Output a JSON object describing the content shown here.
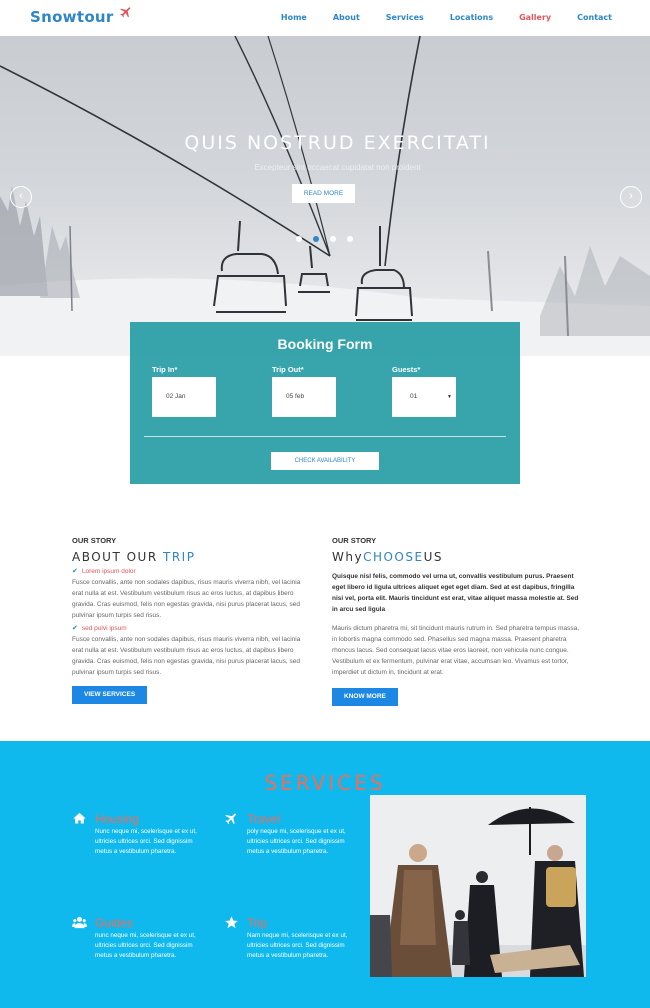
{
  "brand": {
    "name": "Snowtour"
  },
  "nav": {
    "items": [
      {
        "label": "Home",
        "active": false
      },
      {
        "label": "About",
        "active": false
      },
      {
        "label": "Services",
        "active": false
      },
      {
        "label": "Locations",
        "active": false
      },
      {
        "label": "Gallery",
        "active": true
      },
      {
        "label": "Contact",
        "active": false
      }
    ]
  },
  "hero": {
    "title": "QUIS NOSTRUD EXERCITATI",
    "subtitle": "Excepteur sint occaecat cupidatat non proident",
    "button": "READ MORE",
    "prev_icon": "chevron-left-icon",
    "next_icon": "chevron-right-icon",
    "slide_count": 4,
    "active_slide": 2
  },
  "booking": {
    "title": "Booking Form",
    "trip_in": {
      "label": "Trip In*",
      "value": "02 Jan"
    },
    "trip_out": {
      "label": "Trip Out*",
      "value": "05 feb"
    },
    "guests": {
      "label": "Guests*",
      "value": "01"
    },
    "button": "CHECK AVAILABILITY"
  },
  "about": {
    "eyebrow": "OUR STORY",
    "title_plain": "ABOUT OUR ",
    "title_highlight": "TRIP",
    "item1": {
      "heading": "Lorem ipsum dolor",
      "text": "Fusce convallis, ante non sodales dapibus, risus mauris viverra nibh, vel lacinia erat nulla at est. Vestibulum vestibulum risus ac eros luctus, at dapibus libero gravida. Cras euismod, felis non egestas gravida, nisi purus placerat lacus, sed pulvinar ipsum turpis sed risus."
    },
    "item2": {
      "heading": "sed pulvi ipsum",
      "text": "Fusce convallis, ante non sodales dapibus, risus mauris viverra nibh, vel lacinia erat nulla at est. Vestibulum vestibulum risus ac eros luctus, at dapibus libero gravida. Cras euismod, felis non egestas gravida, nisi purus placerat lacus, sed pulvinar ipsum turpis sed risus."
    },
    "button": "VIEW SERVICES"
  },
  "why": {
    "eyebrow": "OUR STORY",
    "title_plain": "Why",
    "title_highlight": "CHOOSE",
    "title_end": "US",
    "bold_text": "Quisque nisl felis, commodo vel urna ut, convallis vestibulum purus. Praesent eget libero id ligula ultrices aliquet eget eget diam. Sed at est dapibus, fringilla nisi vel, porta elit. Mauris tincidunt est erat, vitae aliquet massa molestie at. Sed in arcu sed ligula",
    "text": "Mauris dictum pharetra mi, sit tincidunt mauris rutrum in. Sed pharetra tempus massa, in lobortis magna commodo sed. Phasellus sed magna massa. Praesent pharetra rhoncus lacus. Sed consequat lacus vitae eros laoreet, non vehicula nunc congue. Vestibulum et ex fermentum, pulvinar erat vitae, accumsan leo. Vivamus est tortor, imperdiet ut dictum in, tincidunt at erat.",
    "button": "KNOW MORE"
  },
  "services": {
    "title": "SERVICES",
    "items": [
      {
        "name": "Housing",
        "icon": "home-icon",
        "text": "Nunc neque mi, scelerisque et ex ut, ultricies ultrices orci. Sed dignissim metus a vestibulum pharetra."
      },
      {
        "name": "Travel",
        "icon": "plane-icon",
        "text": "poly neque mi, scelerisque et ex ut, ultricies ultrices orci. Sed dignissim metus a vestibulum pharetra."
      },
      {
        "name": "Guides",
        "icon": "users-icon",
        "text": "nunc neque mi, scelerisque et ex ut, ultricies ultrices orci. Sed dignissim metus a vestibulum pharetra."
      },
      {
        "name": "Trip",
        "icon": "star-icon",
        "text": "Nam neque mi, scelerisque et ex ut, ultricies ultrices orci. Sed dignissim metus a vestibulum pharetra."
      }
    ]
  },
  "colors": {
    "brand": "#2e86c9",
    "accent": "#e0565b",
    "booking_bg": "#1c99a2",
    "services_bg": "#0fb9ee",
    "button": "#1d87e4"
  }
}
